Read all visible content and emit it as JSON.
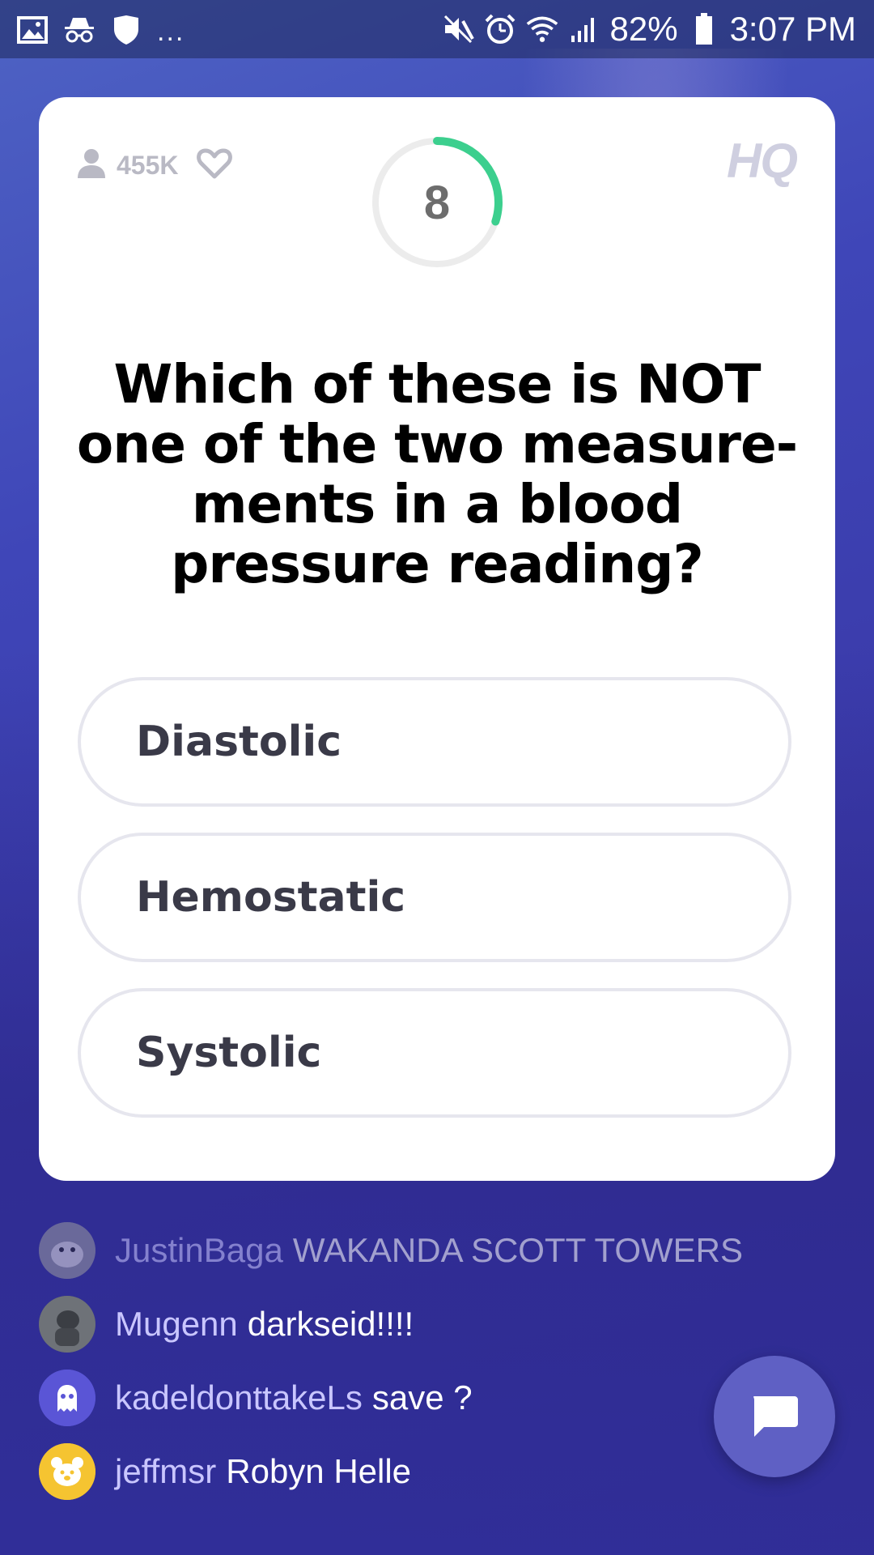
{
  "status_bar": {
    "left_icons": [
      "gallery-icon",
      "incognito-icon",
      "shield-icon"
    ],
    "more": "...",
    "right_icons": [
      "mute-icon",
      "alarm-icon",
      "wifi-icon",
      "signal-icon",
      "battery-icon"
    ],
    "battery_percent": "82%",
    "time": "3:07 PM"
  },
  "game": {
    "viewer_count": "455K",
    "timer_value": "8",
    "timer_fraction_remaining": 0.3,
    "logo": "HQ",
    "question": "Which of these is NOT one of the two measure-ments in a blood pressure reading?",
    "answers": [
      "Diastolic",
      "Hemostatic",
      "Systolic"
    ],
    "accent_color": "#3ccf8e"
  },
  "chat": {
    "messages": [
      {
        "user": "JustinBaga",
        "text": "WAKANDA SCOTT TOWERS"
      },
      {
        "user": "Mugenn",
        "text": "darkseid!!!!"
      },
      {
        "user": "kadeldonttakeLs",
        "text": "save ?"
      },
      {
        "user": "jeffmsr",
        "text": "Robyn Helle"
      }
    ],
    "button_icon": "chat-bubble-icon"
  }
}
